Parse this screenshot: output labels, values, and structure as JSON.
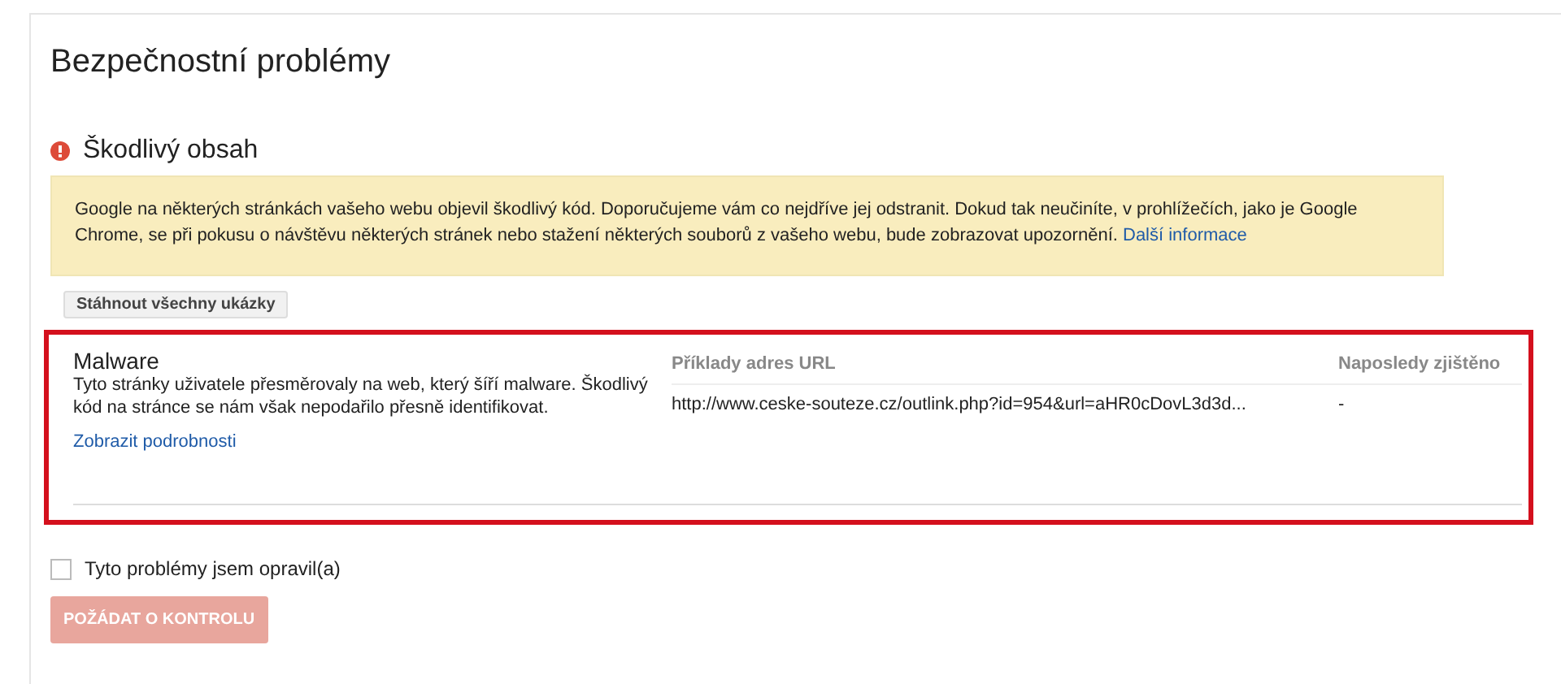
{
  "page_title": "Bezpečnostní problémy",
  "section": {
    "title": "Škodlivý obsah",
    "notice": {
      "text": "Google na některých stránkách vašeho webu objevil škodlivý kód. Doporučujeme vám co nejdříve jej odstranit. Dokud tak neučiníte, v prohlížečích, jako je Google Chrome, se při pokusu o návštěvu některých stránek nebo stažení některých souborů z vašeho webu, bude zobrazovat upozornění.",
      "link": "Další informace"
    },
    "download_button": "Stáhnout všechny ukázky",
    "issues": [
      {
        "title": "Malware",
        "description": "Tyto stránky uživatele přesměrovaly na web, který šíří malware. Škodlivý kód na stránce se nám však nepodařilo přesně identifikovat.",
        "details_link": "Zobrazit podrobnosti",
        "highlighted": true,
        "url_heading": "Příklady adres URL",
        "url": "http://www.ceske-souteze.cz/outlink.php?id=954&url=aHR0cDovL3d3d...",
        "date_heading": "Naposledy zjištěno",
        "date": "-"
      }
    ]
  },
  "fixed_checkbox": {
    "label": "Tyto problémy jsem opravil(a)",
    "checked": false
  },
  "review_button": {
    "label": "POŽÁDAT O KONTROLU",
    "disabled": true
  }
}
